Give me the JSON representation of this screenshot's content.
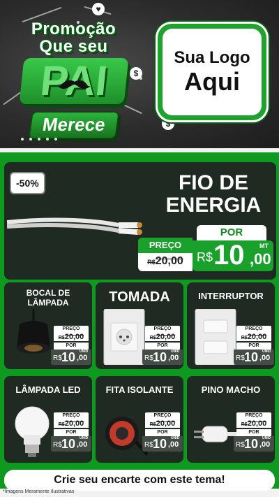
{
  "header": {
    "promo_line1": "Promoção",
    "promo_line2": "Que seu",
    "promo_line3": "PAI",
    "promo_line4": "Merece",
    "logo_line1": "Sua Logo",
    "logo_line2": "Aqui",
    "deco_symbol": "$"
  },
  "featured": {
    "discount": "-50%",
    "title_line1": "FIO DE",
    "title_line2": "ENERGIA",
    "por_label": "POR",
    "preco_label": "PREÇO",
    "old_currency": "R$",
    "old_price": "20,00",
    "currency": "R$",
    "price_int": "10",
    "price_cents": ",00",
    "unit": "MT"
  },
  "products": [
    {
      "title": "BOCAL DE\nLÂMPADA",
      "icon": "lamp-socket-icon",
      "preco_label": "PREÇO",
      "old_currency": "R$",
      "old_price": "20,00",
      "por_label": "POR",
      "currency": "R$",
      "price_int": "10",
      "price_cents": ",00",
      "unit": "UNID"
    },
    {
      "title": "TOMADA",
      "icon": "wall-outlet-icon",
      "preco_label": "PREÇO",
      "old_currency": "R$",
      "old_price": "20,00",
      "por_label": "POR",
      "currency": "R$",
      "price_int": "10",
      "price_cents": ",00",
      "unit": "UNID"
    },
    {
      "title": "INTERRUPTOR",
      "icon": "light-switch-icon",
      "preco_label": "PREÇO",
      "old_currency": "R$",
      "old_price": "20,00",
      "por_label": "POR",
      "currency": "R$",
      "price_int": "10",
      "price_cents": ",00",
      "unit": "UNID"
    },
    {
      "title": "LÂMPADA LED",
      "icon": "led-bulb-icon",
      "preco_label": "PREÇO",
      "old_currency": "R$",
      "old_price": "20,00",
      "por_label": "POR",
      "currency": "R$",
      "price_int": "10",
      "price_cents": ",00",
      "unit": "UNID"
    },
    {
      "title": "FITA ISOLANTE",
      "icon": "insulating-tape-icon",
      "preco_label": "PREÇO",
      "old_currency": "R$",
      "old_price": "20,00",
      "por_label": "POR",
      "currency": "R$",
      "price_int": "10",
      "price_cents": ",00",
      "unit": "UNID"
    },
    {
      "title": "PINO MACHO",
      "icon": "plug-icon",
      "preco_label": "PREÇO",
      "old_currency": "R$",
      "old_price": "20,00",
      "por_label": "POR",
      "currency": "R$",
      "price_int": "10",
      "price_cents": ",00",
      "unit": "UNID"
    }
  ],
  "cta": "Crie seu encarte com este tema!",
  "footer_note": "*Imagens Meramente Ilustrativas",
  "colors": {
    "green": "#0e9a1f",
    "card": "#1f2a22",
    "dark_bg": "#2c2c2c",
    "accent": "#1aa12b"
  }
}
